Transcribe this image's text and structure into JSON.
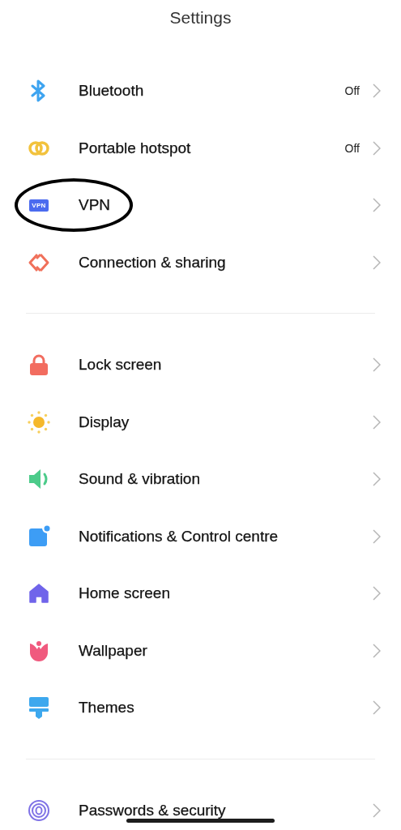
{
  "title": "Settings",
  "groups": [
    {
      "items": [
        {
          "label": "Bluetooth",
          "value": "Off",
          "highlighted": false
        },
        {
          "label": "Portable hotspot",
          "value": "Off",
          "highlighted": false
        },
        {
          "label": "VPN",
          "icon_text": "VPN",
          "highlighted": true
        },
        {
          "label": "Connection & sharing",
          "highlighted": false
        }
      ]
    },
    {
      "items": [
        {
          "label": "Lock screen",
          "highlighted": false
        },
        {
          "label": "Display",
          "highlighted": false
        },
        {
          "label": "Sound & vibration",
          "highlighted": false
        },
        {
          "label": "Notifications & Control centre",
          "highlighted": false
        },
        {
          "label": "Home screen",
          "highlighted": false
        },
        {
          "label": "Wallpaper",
          "highlighted": false
        },
        {
          "label": "Themes",
          "highlighted": false
        }
      ]
    },
    {
      "items": [
        {
          "label": "Passwords & security",
          "highlighted": false
        }
      ]
    }
  ]
}
